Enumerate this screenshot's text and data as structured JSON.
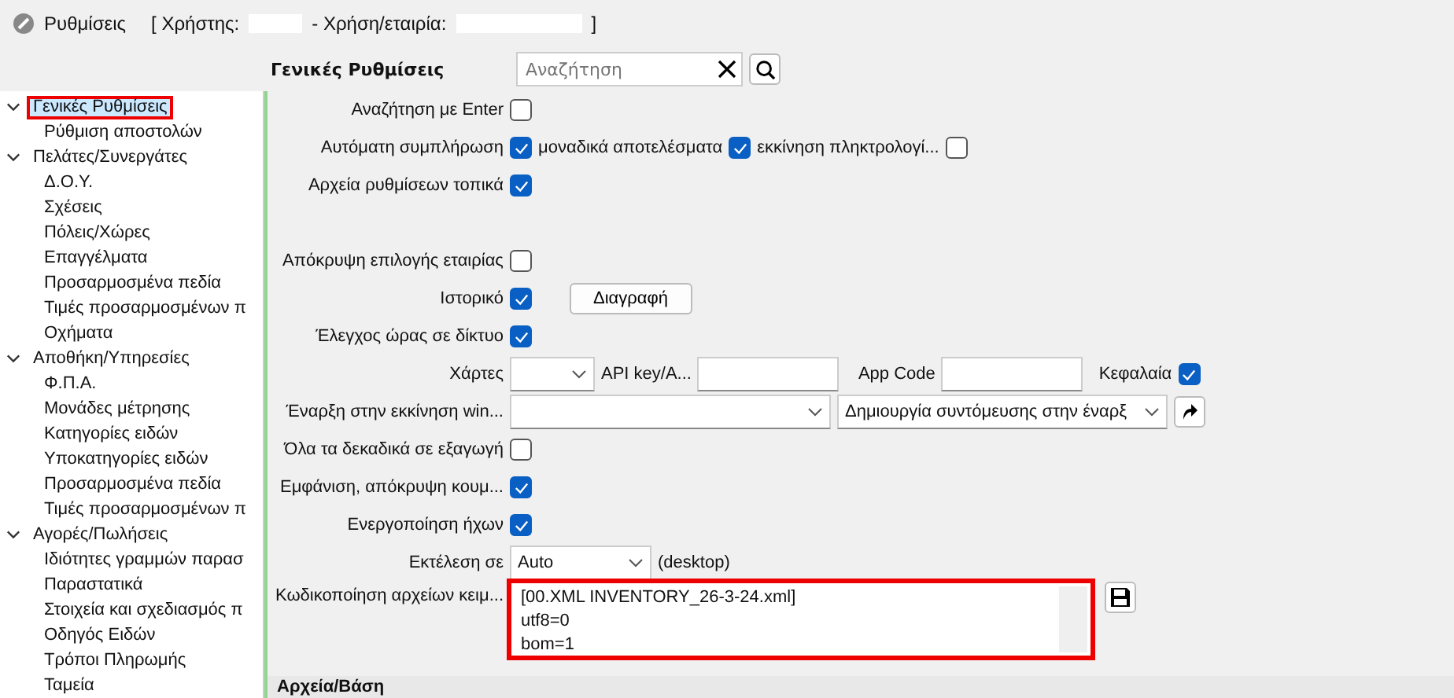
{
  "window": {
    "title": "Ρυθμίσεις",
    "user_label": "[ Χρήστης:",
    "company_label": "- Χρήση/εταιρία:",
    "close_bracket": "]"
  },
  "tree": [
    {
      "label": "Γενικές Ρυθμίσεις",
      "selected": true,
      "highlighted": true,
      "expanded": true,
      "children": [
        {
          "label": "Ρύθμιση αποστολών",
          "selected": false
        }
      ]
    },
    {
      "label": "Πελάτες/Συνεργάτες",
      "selected": false,
      "highlighted": false,
      "expanded": true,
      "children": [
        {
          "label": "Δ.Ο.Υ.",
          "selected": false
        },
        {
          "label": "Σχέσεις",
          "selected": false
        },
        {
          "label": "Πόλεις/Χώρες",
          "selected": false
        },
        {
          "label": "Επαγγέλματα",
          "selected": false
        },
        {
          "label": "Προσαρμοσμένα πεδία",
          "selected": false
        },
        {
          "label": "Τιμές προσαρμοσμένων π",
          "selected": false
        },
        {
          "label": "Οχήματα",
          "selected": false
        }
      ]
    },
    {
      "label": "Αποθήκη/Υπηρεσίες",
      "selected": false,
      "highlighted": false,
      "expanded": true,
      "children": [
        {
          "label": "Φ.Π.Α.",
          "selected": false
        },
        {
          "label": "Μονάδες μέτρησης",
          "selected": false
        },
        {
          "label": "Κατηγορίες ειδών",
          "selected": false
        },
        {
          "label": "Υποκατηγορίες ειδών",
          "selected": false
        },
        {
          "label": "Προσαρμοσμένα πεδία",
          "selected": false
        },
        {
          "label": "Τιμές προσαρμοσμένων π",
          "selected": false
        }
      ]
    },
    {
      "label": "Αγορές/Πωλήσεις",
      "selected": false,
      "highlighted": false,
      "expanded": true,
      "children": [
        {
          "label": "Ιδιότητες γραμμών παρασ",
          "selected": false
        },
        {
          "label": "Παραστατικά",
          "selected": false
        },
        {
          "label": "Στοιχεία και σχεδιασμός π",
          "selected": false
        },
        {
          "label": "Οδηγός Ειδών",
          "selected": false
        },
        {
          "label": "Τρόποι Πληρωμής",
          "selected": false
        },
        {
          "label": "Ταμεία",
          "selected": false
        }
      ]
    }
  ],
  "header": {
    "title": "Γενικές Ρυθμίσεις",
    "search": {
      "placeholder": "Αναζήτηση"
    }
  },
  "rows": [
    {
      "kind": "check",
      "label": "Αναζήτηση με Enter",
      "checked": false
    },
    {
      "kind": "multi",
      "label": "Αυτόματη συμπλήρωση",
      "checked": true,
      "extras": [
        {
          "label": "μοναδικά αποτελέσματα",
          "checked": true
        },
        {
          "label": "εκκίνηση πληκτρολογί...",
          "checked": false
        }
      ]
    },
    {
      "kind": "check",
      "label": "Αρχεία ρυθμίσεων τοπικά",
      "checked": true
    },
    {
      "kind": "spacer"
    },
    {
      "kind": "check",
      "label": "Απόκρυψη επιλογής εταιρίας",
      "checked": false
    },
    {
      "kind": "button",
      "label": "Ιστορικό",
      "checked": true,
      "button": "Διαγραφή"
    },
    {
      "kind": "check",
      "label": "Έλεγχος ώρας σε δίκτυο",
      "checked": true
    },
    {
      "kind": "maps",
      "label": "Χάρτες",
      "api_label": "API key/A...",
      "app_label": "App Code",
      "caps_label": "Κεφαλαία",
      "checked": true
    },
    {
      "kind": "startup",
      "label": "Έναρξη στην εκκίνηση win...",
      "option": "Δημιουργία συντόμευσης στην έναρξ"
    },
    {
      "kind": "check",
      "label": "Όλα τα δεκαδικά σε εξαγωγή",
      "checked": false
    },
    {
      "kind": "check",
      "label": "Εμφάνιση, απόκρυψη κουμ...",
      "checked": true
    },
    {
      "kind": "check",
      "label": "Ενεργοποίηση ήχων",
      "checked": true
    },
    {
      "kind": "select",
      "label": "Εκτέλεση σε",
      "value": "Auto",
      "suffix": "(desktop)"
    },
    {
      "kind": "text",
      "label": "Κωδικοποίηση αρχείων κειμ...",
      "highlighted": true,
      "lines": [
        "[00.XML INVENTORY_26-3-24.xml]",
        "utf8=0",
        "bom=1"
      ]
    }
  ],
  "section": {
    "title": "Αρχεία/Βάση"
  }
}
